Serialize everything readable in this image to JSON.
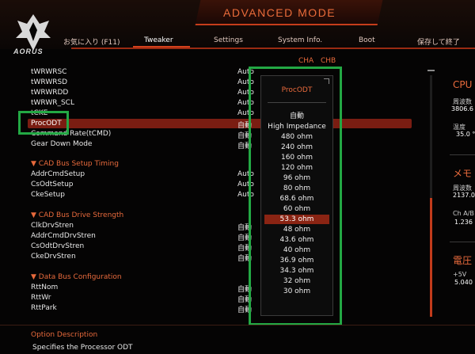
{
  "header": {
    "title": "ADVANCED MODE",
    "brand": "AORUS",
    "tabs": [
      {
        "label": "お気に入り (F11)",
        "active": false
      },
      {
        "label": "Tweaker",
        "active": true
      },
      {
        "label": "Settings",
        "active": false
      },
      {
        "label": "System Info.",
        "active": false
      },
      {
        "label": "Boot",
        "active": false
      },
      {
        "label": "保存して終了",
        "active": false
      }
    ],
    "channels": [
      "CHA",
      "CHB"
    ]
  },
  "settings": [
    {
      "label": "tWRWRSC",
      "value": "Auto"
    },
    {
      "label": "tWRWRSD",
      "value": "Auto"
    },
    {
      "label": "tWRWRDD",
      "value": "Auto"
    },
    {
      "label": "tWRWR_SCL",
      "value": "Auto"
    },
    {
      "label": "tCKE",
      "value": "Auto"
    },
    {
      "label": "ProcODT",
      "value": "自動"
    },
    {
      "label": "Command Rate(tCMD)",
      "value": "自動"
    },
    {
      "label": "Gear Down Mode",
      "value": "自動"
    }
  ],
  "sections": [
    {
      "title": "▼ CAD Bus Setup Timing",
      "items": [
        {
          "label": "AddrCmdSetup",
          "value": "Auto"
        },
        {
          "label": "CsOdtSetup",
          "value": "Auto"
        },
        {
          "label": "CkeSetup",
          "value": "Auto"
        }
      ]
    },
    {
      "title": "▼ CAD Bus Drive Strength",
      "items": [
        {
          "label": "ClkDrvStren",
          "value": "自動"
        },
        {
          "label": "AddrCmdDrvStren",
          "value": "自動"
        },
        {
          "label": "CsOdtDrvStren",
          "value": "自動"
        },
        {
          "label": "CkeDrvStren",
          "value": "自動"
        }
      ]
    },
    {
      "title": "▼ Data Bus Configuration",
      "items": [
        {
          "label": "RttNom",
          "value": "自動"
        },
        {
          "label": "RttWr",
          "value": "自動"
        },
        {
          "label": "RttPark",
          "value": "自動"
        }
      ]
    }
  ],
  "popup": {
    "title": "ProcODT",
    "options": [
      "自動",
      "High Impedance",
      "480 ohm",
      "240 ohm",
      "160 ohm",
      "120 ohm",
      "96 ohm",
      "80 ohm",
      "68.6 ohm",
      "60 ohm",
      "53.3 ohm",
      "48 ohm",
      "43.6 ohm",
      "40 ohm",
      "36.9 ohm",
      "34.3 ohm",
      "32 ohm",
      "30 ohm"
    ],
    "selected_index": 10
  },
  "right_panel": {
    "cpu": {
      "title": "CPU",
      "freq_label": "周波数",
      "freq_value": "3806.6",
      "temp_label": "温度",
      "temp_value": "35.0 °"
    },
    "memory": {
      "title": "メモ",
      "freq_label": "周波数",
      "freq_value": "2137.0",
      "ch_label": "Ch A/B",
      "ch_value": "1.236"
    },
    "voltage": {
      "title": "電圧",
      "label": "+5V",
      "value": "5.040"
    }
  },
  "option_description": {
    "title": "Option Description",
    "text": "Specifies the Processor ODT"
  },
  "colors": {
    "accent": "#e86a3c",
    "highlight": "#7a1d12",
    "focus_box": "#23a844"
  }
}
